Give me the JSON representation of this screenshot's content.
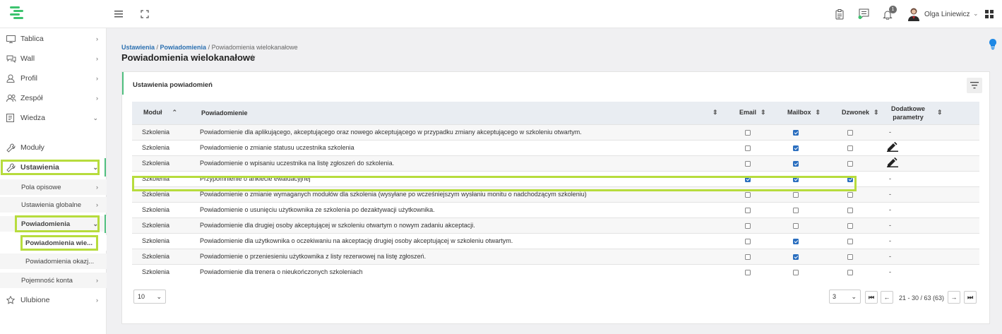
{
  "user": {
    "name": "Olga Liniewicz"
  },
  "notifications_count": "1",
  "sidebar": {
    "items": [
      {
        "label": "Tablica",
        "icon": "monitor-icon"
      },
      {
        "label": "Wall",
        "icon": "chat-icon"
      },
      {
        "label": "Profil",
        "icon": "user-icon"
      },
      {
        "label": "Zespół",
        "icon": "team-icon"
      },
      {
        "label": "Wiedza",
        "icon": "book-icon"
      },
      {
        "label": "Moduły",
        "icon": "wrench-icon"
      },
      {
        "label": "Ustawienia",
        "icon": "wrench-icon"
      },
      {
        "label": "Ulubione",
        "icon": "star-icon"
      }
    ],
    "sub": {
      "pola": "Pola opisowe",
      "globalne": "Ustawienia globalne",
      "powiadomienia": "Powiadomienia",
      "wielokanalowe": "Powiadomienia wie...",
      "okazjonalne": "Powiadomienia okazj...",
      "pojemnosc": "Pojemność konta"
    }
  },
  "breadcrumb": {
    "part1": "Ustawienia",
    "sep1": " / ",
    "part2": "Powiadomienia",
    "sep2": " / ",
    "part3": "Powiadomienia wielokanałowe"
  },
  "page_title": "Powiadomienia wielokanałowe",
  "card_title": "Ustawienia powiadomień",
  "table": {
    "headers": {
      "modul": "Moduł",
      "powiadomienie": "Powiadomienie",
      "email": "Email",
      "mailbox": "Mailbox",
      "dzwonek": "Dzwonek",
      "dodatkowe1": "Dodatkowe",
      "dodatkowe2": "parametry"
    },
    "rows": [
      {
        "modul": "Szkolenia",
        "text": "Powiadomienie dla aplikującego, akceptującego oraz nowego akceptującego w przypadku zmiany akceptującego w szkoleniu otwartym.",
        "email": false,
        "mailbox": true,
        "dzwonek": false,
        "extra": "-"
      },
      {
        "modul": "Szkolenia",
        "text": "Powiadomienie o zmianie statusu uczestnika szkolenia",
        "email": false,
        "mailbox": true,
        "dzwonek": false,
        "extra": "edit"
      },
      {
        "modul": "Szkolenia",
        "text": "Powiadomienie o wpisaniu uczestnika na listę zgłoszeń do szkolenia.",
        "email": false,
        "mailbox": true,
        "dzwonek": false,
        "extra": "edit"
      },
      {
        "modul": "Szkolenia",
        "text": "Przypomnienie o ankiecie ewaluacyjnej",
        "email": true,
        "mailbox": true,
        "dzwonek": true,
        "extra": "-"
      },
      {
        "modul": "Szkolenia",
        "text": "Powiadomienie o zmianie wymaganych modułów dla szkolenia (wysyłane po wcześniejszym wysłaniu monitu o nadchodzącym szkoleniu)",
        "email": false,
        "mailbox": false,
        "dzwonek": false,
        "extra": "-"
      },
      {
        "modul": "Szkolenia",
        "text": "Powiadomienie o usunięciu użytkownika ze szkolenia po dezaktywacji użytkownika.",
        "email": false,
        "mailbox": false,
        "dzwonek": false,
        "extra": "-"
      },
      {
        "modul": "Szkolenia",
        "text": "Powiadomienie dla drugiej osoby akceptującej w szkoleniu otwartym o nowym zadaniu akceptacji.",
        "email": false,
        "mailbox": false,
        "dzwonek": false,
        "extra": "-"
      },
      {
        "modul": "Szkolenia",
        "text": "Powiadomienie dla użytkownika o oczekiwaniu na akceptację drugiej osoby akceptującej w szkoleniu otwartym.",
        "email": false,
        "mailbox": true,
        "dzwonek": false,
        "extra": "-"
      },
      {
        "modul": "Szkolenia",
        "text": "Powiadomienie o przeniesieniu użytkownika z listy rezerwowej na listę zgłoszeń.",
        "email": false,
        "mailbox": true,
        "dzwonek": false,
        "extra": "-"
      },
      {
        "modul": "Szkolenia",
        "text": "Powiadomienie dla trenera o nieukończonych szkoleniach",
        "email": false,
        "mailbox": false,
        "dzwonek": false,
        "extra": "-"
      }
    ]
  },
  "pagination": {
    "per_page": "10",
    "page": "3",
    "info": "21 - 30 / 63 (63)"
  },
  "colors": {
    "accent_green": "#4fbf7f",
    "highlight": "#b7dc3d",
    "link": "#2a6fb0",
    "checkbox_on": "#2a6ebf"
  }
}
